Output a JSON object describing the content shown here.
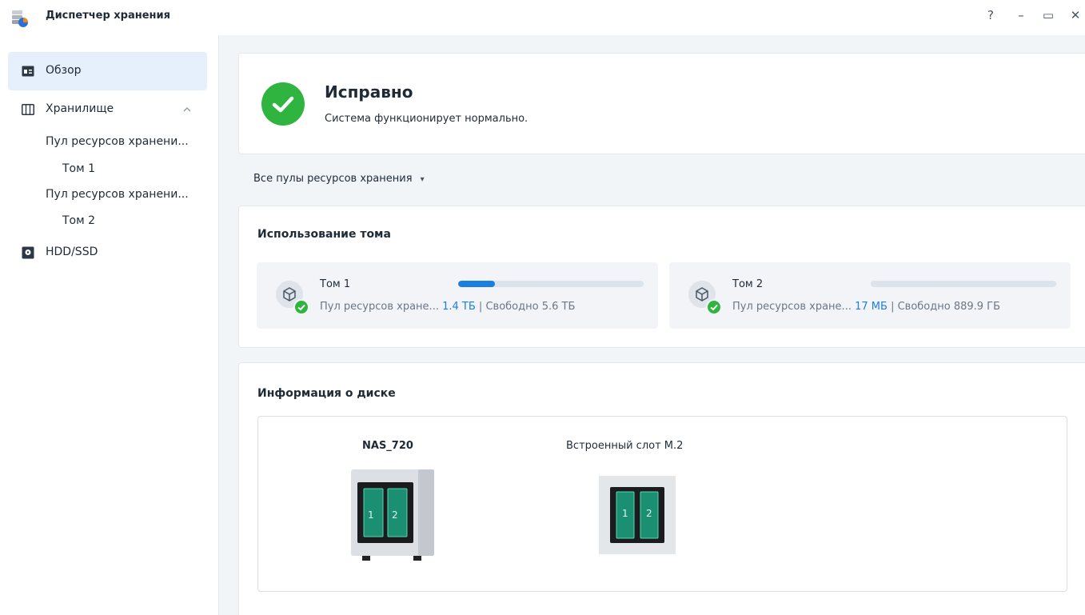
{
  "window": {
    "title": "Диспетчер хранения",
    "controls": {
      "help": "?",
      "minimize": "–",
      "maximize": "▭",
      "close": "✕"
    }
  },
  "sidebar": {
    "overview": "Обзор",
    "storage": "Хранилище",
    "pool1": "Пул ресурсов хранени...",
    "vol1": "Том 1",
    "pool2": "Пул ресурсов хранени...",
    "vol2": "Том 2",
    "hdd": "HDD/SSD"
  },
  "status": {
    "title": "Исправно",
    "subtitle": "Система функционирует нормально."
  },
  "filter": {
    "label": "Все пулы ресурсов хранения",
    "arrow": "▾"
  },
  "volume_usage": {
    "title": "Использование тома",
    "separator": "|",
    "volumes": [
      {
        "name": "Том 1",
        "pool": "Пул ресурсов хране...",
        "used": "1.4 ТБ",
        "free": "Свободно 5.6 ТБ",
        "usage_fraction": 0.2
      },
      {
        "name": "Том 2",
        "pool": "Пул ресурсов хране...",
        "used": "17 МБ",
        "free": "Свободно 889.9 ГБ",
        "usage_fraction": 0.0
      }
    ]
  },
  "disk_info": {
    "title": "Информация о диске",
    "devices": [
      {
        "name": "NAS_720",
        "slots": [
          "1",
          "2"
        ]
      },
      {
        "name": "Встроенный слот M.2",
        "slots": [
          "1",
          "2"
        ]
      }
    ]
  },
  "colors": {
    "accent": "#1b7fe1",
    "success": "#2fb53f",
    "active_bg": "#e6f0fc",
    "background": "#f2f5f8"
  }
}
